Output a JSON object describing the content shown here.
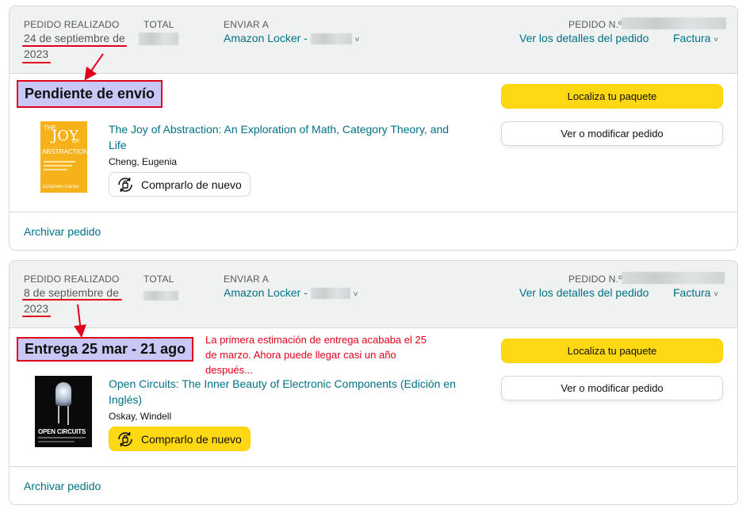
{
  "colors": {
    "link": "#007185",
    "button_yellow": "#ffd814",
    "annotation_red": "#e0001b",
    "highlight_fill": "#c8c7f5"
  },
  "labels": {
    "placed": "PEDIDO REALIZADO",
    "total": "TOTAL",
    "ship_to": "ENVIAR A",
    "order_no": "PEDIDO N.º",
    "details": "Ver los detalles del pedido",
    "invoice": "Factura",
    "track": "Localiza tu paquete",
    "modify": "Ver o modificar pedido",
    "buy_again": "Comprarlo de nuevo",
    "archive": "Archivar pedido"
  },
  "orders": [
    {
      "date_line1": "24 de septiembre de",
      "date_line2": "2023",
      "ship_to": "Amazon Locker - ",
      "status": "Pendiente de envío",
      "product_title": "The Joy of Abstraction: An Exploration of Math, Category Theory, and Life",
      "author": "Cheng, Eugenia",
      "cover": {
        "line1": "THE",
        "line2": "JOY",
        "line3": "OF",
        "line4": "ABSTRACTION",
        "author": "EUGENIA CHENG"
      }
    },
    {
      "date_line1": "8 de septiembre de",
      "date_line2": "2023",
      "ship_to": "Amazon Locker - ",
      "status": "Entrega 25 mar - 21 ago",
      "product_title": "Open Circuits: The Inner Beauty of Electronic Components (Edición en Inglés)",
      "author": "Oskay, Windell",
      "cover": {
        "title": "OPEN CIRCUITS"
      }
    }
  ],
  "annotation": "La primera estimación de entrega acababa el 25 de marzo. Ahora puede llegar casi un año después..."
}
